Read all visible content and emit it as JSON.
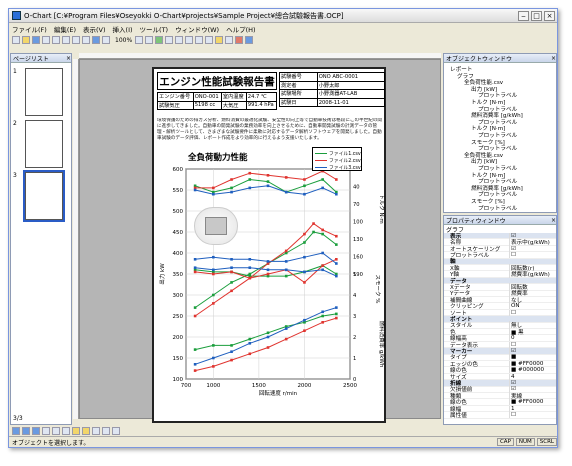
{
  "window": {
    "title": "O-Chart [C:¥Program Files¥Oseyokki O-Chart¥projects¥Sample Project¥總合試驗報告書.OCP]"
  },
  "menu": [
    "ファイル(F)",
    "編集(E)",
    "表示(V)",
    "挿入(I)",
    "ツール(T)",
    "ウィンドウ(W)",
    "ヘルプ(H)"
  ],
  "toolbar": {
    "zoom": "100%"
  },
  "pages_panel": {
    "title": "ページリスト",
    "pages": [
      "1",
      "2",
      "3"
    ],
    "page_indicator": "3/3"
  },
  "report": {
    "title": "エンジン性能試験報告書",
    "rows_left": [
      [
        "エンジン番号",
        "ONO-001",
        "室内温度",
        "24.7 ℃"
      ],
      [
        "試験気圧",
        "5198 cc",
        "大気圧",
        "991.4 hPa"
      ]
    ],
    "rows_right": [
      [
        "試験番号",
        "ONO ABC-0001"
      ],
      [
        "測定者",
        "小野太郎"
      ],
      [
        "試験場所",
        "小野測器AT-LAB"
      ],
      [
        "試験日",
        "2008-11-01"
      ]
    ],
    "description": "環境保護のための排ガス分析、燃料消費の最適化試験、安全性の向上等で自動車技術は格段にこの半世紀の間に進歩してきました。自動車の開発試験の業務効率を向上させるために、自動車開発試験の計測データの管理・解析ツールとして、さまざまな試験要件に柔軟に対応するデータ解析ソフトウェアを開発しました。自動車試験のデータ評価、レポート作成をより効率的に行えるよう支援いたします。"
  },
  "chart_data": {
    "type": "line",
    "title": "全負荷動力性能",
    "xlabel": "回転速度 r/min",
    "ylabel_left": "出力 kW",
    "ylabel_right_top": "トルク N·m",
    "ylabel_right_bottom": "燃料消費率 g/kWh",
    "xlim": [
      700,
      2500
    ],
    "x_ticks": [
      700,
      1000,
      1500,
      2000,
      2500
    ],
    "left_ticks": [
      100,
      150,
      200,
      250,
      300,
      350,
      400,
      450,
      500,
      550,
      600
    ],
    "right_ticks_top": [
      10,
      40,
      70,
      100,
      130,
      160,
      190
    ],
    "right_ticks_bottom": [
      0,
      1,
      2,
      3,
      4,
      5
    ],
    "right_mid_label": "スモーク %",
    "grid": true,
    "legend": {
      "position": "top-right",
      "items": [
        "ファイル1.csv",
        "ファイル2.csv",
        "ファイル3.csv"
      ]
    },
    "series": [
      {
        "name": "ファイル1.csv",
        "color": "#1a9e3c",
        "groups": {
          "torque": [
            [
              800,
              560
            ],
            [
              1000,
              545
            ],
            [
              1200,
              555
            ],
            [
              1400,
              575
            ],
            [
              1600,
              570
            ],
            [
              1800,
              545
            ],
            [
              2000,
              560
            ],
            [
              2200,
              575
            ],
            [
              2350,
              545
            ]
          ],
          "power": [
            [
              800,
              270
            ],
            [
              1000,
              300
            ],
            [
              1200,
              330
            ],
            [
              1400,
              350
            ],
            [
              1600,
              375
            ],
            [
              1800,
              400
            ],
            [
              2000,
              425
            ],
            [
              2100,
              450
            ],
            [
              2200,
              445
            ],
            [
              2350,
              420
            ]
          ],
          "smoke": [
            [
              800,
              360
            ],
            [
              1000,
              355
            ],
            [
              1200,
              355
            ],
            [
              1400,
              345
            ],
            [
              1600,
              345
            ],
            [
              1800,
              345
            ],
            [
              2000,
              355
            ],
            [
              2200,
              370
            ],
            [
              2350,
              350
            ]
          ],
          "fuel": [
            [
              800,
              170
            ],
            [
              1000,
              180
            ],
            [
              1200,
              180
            ],
            [
              1400,
              195
            ],
            [
              1600,
              210
            ],
            [
              1800,
              225
            ],
            [
              2000,
              235
            ],
            [
              2200,
              250
            ],
            [
              2350,
              255
            ]
          ]
        }
      },
      {
        "name": "ファイル2.csv",
        "color": "#e0342f",
        "groups": {
          "torque": [
            [
              800,
              555
            ],
            [
              1000,
              555
            ],
            [
              1200,
              575
            ],
            [
              1400,
              590
            ],
            [
              1600,
              585
            ],
            [
              1800,
              580
            ],
            [
              2000,
              575
            ],
            [
              2200,
              595
            ],
            [
              2350,
              575
            ]
          ],
          "power": [
            [
              800,
              250
            ],
            [
              1000,
              280
            ],
            [
              1200,
              310
            ],
            [
              1400,
              340
            ],
            [
              1600,
              375
            ],
            [
              1800,
              405
            ],
            [
              2000,
              445
            ],
            [
              2100,
              470
            ],
            [
              2200,
              455
            ],
            [
              2350,
              440
            ]
          ],
          "smoke": [
            [
              800,
              355
            ],
            [
              1000,
              350
            ],
            [
              1200,
              355
            ],
            [
              1400,
              340
            ],
            [
              1600,
              350
            ],
            [
              1800,
              360
            ],
            [
              2000,
              330
            ],
            [
              2200,
              370
            ],
            [
              2350,
              385
            ]
          ],
          "fuel": [
            [
              800,
              120
            ],
            [
              1000,
              130
            ],
            [
              1200,
              145
            ],
            [
              1400,
              160
            ],
            [
              1600,
              175
            ],
            [
              1800,
              195
            ],
            [
              2000,
              215
            ],
            [
              2200,
              235
            ],
            [
              2350,
              245
            ]
          ]
        }
      },
      {
        "name": "ファイル3.csv",
        "color": "#1f5fbf",
        "groups": {
          "torque": [
            [
              800,
              550
            ],
            [
              1000,
              540
            ],
            [
              1200,
              545
            ],
            [
              1400,
              555
            ],
            [
              1600,
              560
            ],
            [
              1800,
              545
            ],
            [
              2000,
              540
            ],
            [
              2200,
              555
            ],
            [
              2350,
              540
            ]
          ],
          "power": [
            [
              800,
              385
            ],
            [
              1000,
              390
            ],
            [
              1200,
              385
            ],
            [
              1400,
              385
            ],
            [
              1600,
              380
            ],
            [
              1800,
              380
            ],
            [
              2000,
              390
            ],
            [
              2200,
              400
            ],
            [
              2350,
              375
            ]
          ],
          "smoke": [
            [
              800,
              365
            ],
            [
              1000,
              360
            ],
            [
              1200,
              365
            ],
            [
              1400,
              365
            ],
            [
              1600,
              360
            ],
            [
              1800,
              360
            ],
            [
              2000,
              355
            ],
            [
              2200,
              360
            ],
            [
              2350,
              345
            ]
          ],
          "fuel": [
            [
              800,
              135
            ],
            [
              1000,
              150
            ],
            [
              1200,
              165
            ],
            [
              1400,
              185
            ],
            [
              1600,
              200
            ],
            [
              1800,
              220
            ],
            [
              2000,
              240
            ],
            [
              2200,
              260
            ],
            [
              2350,
              270
            ]
          ]
        }
      }
    ]
  },
  "object_window": {
    "title": "オブジェクトウィンドウ",
    "items": [
      {
        "t": "レポート",
        "lv": 0
      },
      {
        "t": "グラフ",
        "lv": 1
      },
      {
        "t": "全負荷性能.csv",
        "lv": 2
      },
      {
        "t": "出力 [kW]",
        "lv": 3
      },
      {
        "t": "プロットラベル",
        "lv": 4
      },
      {
        "t": "トルク [N·m]",
        "lv": 3
      },
      {
        "t": "プロットラベル",
        "lv": 4
      },
      {
        "t": "燃料消費率 [g/kWh]",
        "lv": 3
      },
      {
        "t": "プロットラベル",
        "lv": 4
      },
      {
        "t": "トルク [N·m]",
        "lv": 3
      },
      {
        "t": "プロットラベル",
        "lv": 4
      },
      {
        "t": "スモーク [%]",
        "lv": 3
      },
      {
        "t": "プロットラベル",
        "lv": 4
      },
      {
        "t": "全負荷性能.csv",
        "lv": 2
      },
      {
        "t": "出力 [kW]",
        "lv": 3
      },
      {
        "t": "プロットラベル",
        "lv": 4
      },
      {
        "t": "トルク [N·m]",
        "lv": 3
      },
      {
        "t": "プロットラベル",
        "lv": 4
      },
      {
        "t": "燃料消費率 [g/kWh]",
        "lv": 3
      },
      {
        "t": "プロットラベル",
        "lv": 4
      },
      {
        "t": "スモーク [%]",
        "lv": 3
      },
      {
        "t": "プロットラベル",
        "lv": 4
      }
    ]
  },
  "property_window": {
    "title": "プロパティウィンドウ",
    "header": "グラフ",
    "rows": [
      {
        "k": "表示",
        "v": "☑",
        "cat": true
      },
      {
        "k": "名称",
        "v": "表示中(g/kWh)"
      },
      {
        "k": "オートスケーリング",
        "v": "☑"
      },
      {
        "k": "プロットラベル",
        "v": "☐"
      },
      {
        "k": "軸",
        "v": "",
        "cat": true
      },
      {
        "k": "X軸",
        "v": "回転数(r)"
      },
      {
        "k": "Y軸",
        "v": "燃費率(g/kWh)"
      },
      {
        "k": "データ",
        "v": "",
        "cat": true
      },
      {
        "k": "Xデータ",
        "v": "回転数"
      },
      {
        "k": "Yデータ",
        "v": "燃費率"
      },
      {
        "k": "補間曲線",
        "v": "なし"
      },
      {
        "k": "クリッピング",
        "v": "ON"
      },
      {
        "k": "ソート",
        "v": "☐"
      },
      {
        "k": "ポイント",
        "v": "",
        "cat": true
      },
      {
        "k": "スタイル",
        "v": "無し"
      },
      {
        "k": "色",
        "v": "■ 黒"
      },
      {
        "k": "線幅高",
        "v": "0"
      },
      {
        "k": "データ表示",
        "v": "☐"
      },
      {
        "k": "マーカー",
        "v": "☑",
        "cat": true
      },
      {
        "k": "タイプ",
        "v": "■"
      },
      {
        "k": "エッジの色",
        "v": "■ #FF0000"
      },
      {
        "k": "線の色",
        "v": "■ #000000"
      },
      {
        "k": "サイズ",
        "v": "4"
      },
      {
        "k": "折線",
        "v": "☑",
        "cat": true
      },
      {
        "k": "欠損値前",
        "v": "☑"
      },
      {
        "k": "種類",
        "v": "実線"
      },
      {
        "k": "線の色",
        "v": "■ #FF0000"
      },
      {
        "k": "線幅",
        "v": "1"
      },
      {
        "k": "属性値",
        "v": "☐"
      }
    ]
  },
  "status": {
    "text": "オブジェクトを選択します。",
    "caps": "CAP",
    "num": "NUM",
    "scrl": "SCRL"
  },
  "colors": {
    "accent": "#2a5cc6",
    "green": "#1a9e3c",
    "red": "#e0342f",
    "blue": "#1f5fbf"
  }
}
